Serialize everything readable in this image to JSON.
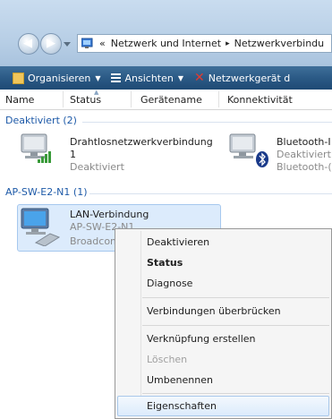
{
  "address": {
    "overflow": "«",
    "crumb1": "Netzwerk und Internet",
    "separator": "▸",
    "crumb2": "Netzwerkverbindu"
  },
  "toolbar": {
    "organize": "Organisieren",
    "views": "Ansichten",
    "delete_device": "Netzwerkgerät d",
    "dropdown_glyph": "▼"
  },
  "columns": [
    "Name",
    "Status",
    "Gerätename",
    "Konnektivität"
  ],
  "groups": [
    {
      "label": "Deaktiviert (2)",
      "items": [
        {
          "name_line1": "Drahtlosnetzwerkverbindung",
          "name_line2": "1",
          "status": "Deaktiviert"
        },
        {
          "name_line1": "Bluetooth-I",
          "status": "Deaktiviert",
          "device": "Bluetooth-("
        }
      ]
    },
    {
      "label": "AP-SW-E2-N1 (1)",
      "items": [
        {
          "name_line1": "LAN-Verbindung",
          "status": "AP-SW-E2-N1",
          "device": "Broadcom"
        }
      ]
    }
  ],
  "context_menu": {
    "items": [
      "Deaktivieren",
      "Status",
      "Diagnose",
      "Verbindungen überbrücken",
      "Verknüpfung erstellen",
      "Löschen",
      "Umbenennen",
      "Eigenschaften"
    ],
    "bold_item": "Status",
    "disabled_item": "Löschen",
    "highlighted_item": "Eigenschaften"
  },
  "colors": {
    "toolbar": "#2b5a86",
    "group_text": "#1e5aa8",
    "selection": "#dcebfc"
  }
}
